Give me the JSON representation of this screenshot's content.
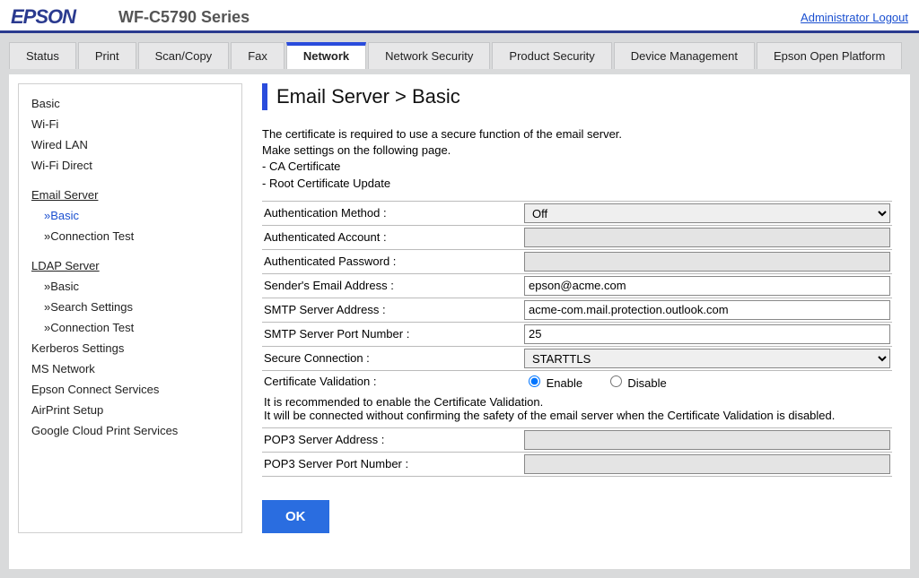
{
  "header": {
    "brand": "EPSON",
    "model": "WF-C5790 Series",
    "logout": "Administrator Logout"
  },
  "tabs": [
    "Status",
    "Print",
    "Scan/Copy",
    "Fax",
    "Network",
    "Network Security",
    "Product Security",
    "Device Management",
    "Epson Open Platform"
  ],
  "sidebar": {
    "items": [
      {
        "label": "Basic",
        "type": "item"
      },
      {
        "label": "Wi-Fi",
        "type": "item"
      },
      {
        "label": "Wired LAN",
        "type": "item"
      },
      {
        "label": "Wi-Fi Direct",
        "type": "item"
      },
      {
        "label": "Email Server",
        "type": "header"
      },
      {
        "label": "»Basic",
        "type": "sub",
        "active": true
      },
      {
        "label": "»Connection Test",
        "type": "sub"
      },
      {
        "label": "LDAP Server",
        "type": "header"
      },
      {
        "label": "»Basic",
        "type": "sub"
      },
      {
        "label": "»Search Settings",
        "type": "sub"
      },
      {
        "label": "»Connection Test",
        "type": "sub"
      },
      {
        "label": "Kerberos Settings",
        "type": "item"
      },
      {
        "label": "MS Network",
        "type": "item"
      },
      {
        "label": "Epson Connect Services",
        "type": "item"
      },
      {
        "label": "AirPrint Setup",
        "type": "item"
      },
      {
        "label": "Google Cloud Print Services",
        "type": "item"
      }
    ]
  },
  "page": {
    "title": "Email Server > Basic",
    "info1": "The certificate is required to use a secure function of the email server.",
    "info2": "Make settings on the following page.",
    "info3": "- CA Certificate",
    "info4": "- Root Certificate Update",
    "rows": {
      "auth_method_label": "Authentication Method :",
      "auth_method_value": "Off",
      "auth_account_label": "Authenticated Account :",
      "auth_account_value": "",
      "auth_password_label": "Authenticated Password :",
      "auth_password_value": "",
      "sender_label": "Sender's Email Address :",
      "sender_value": "epson@acme.com",
      "smtp_addr_label": "SMTP Server Address :",
      "smtp_addr_value": "acme-com.mail.protection.outlook.com",
      "smtp_port_label": "SMTP Server Port Number :",
      "smtp_port_value": "25",
      "secure_conn_label": "Secure Connection :",
      "secure_conn_value": "STARTTLS",
      "cert_valid_label": "Certificate Validation :",
      "cert_valid_enable": "Enable",
      "cert_valid_disable": "Disable",
      "note1": "It is recommended to enable the Certificate Validation.",
      "note2": "It will be connected without confirming the safety of the email server when the Certificate Validation is disabled.",
      "pop3_addr_label": "POP3 Server Address :",
      "pop3_addr_value": "",
      "pop3_port_label": "POP3 Server Port Number :",
      "pop3_port_value": ""
    },
    "ok": "OK"
  }
}
